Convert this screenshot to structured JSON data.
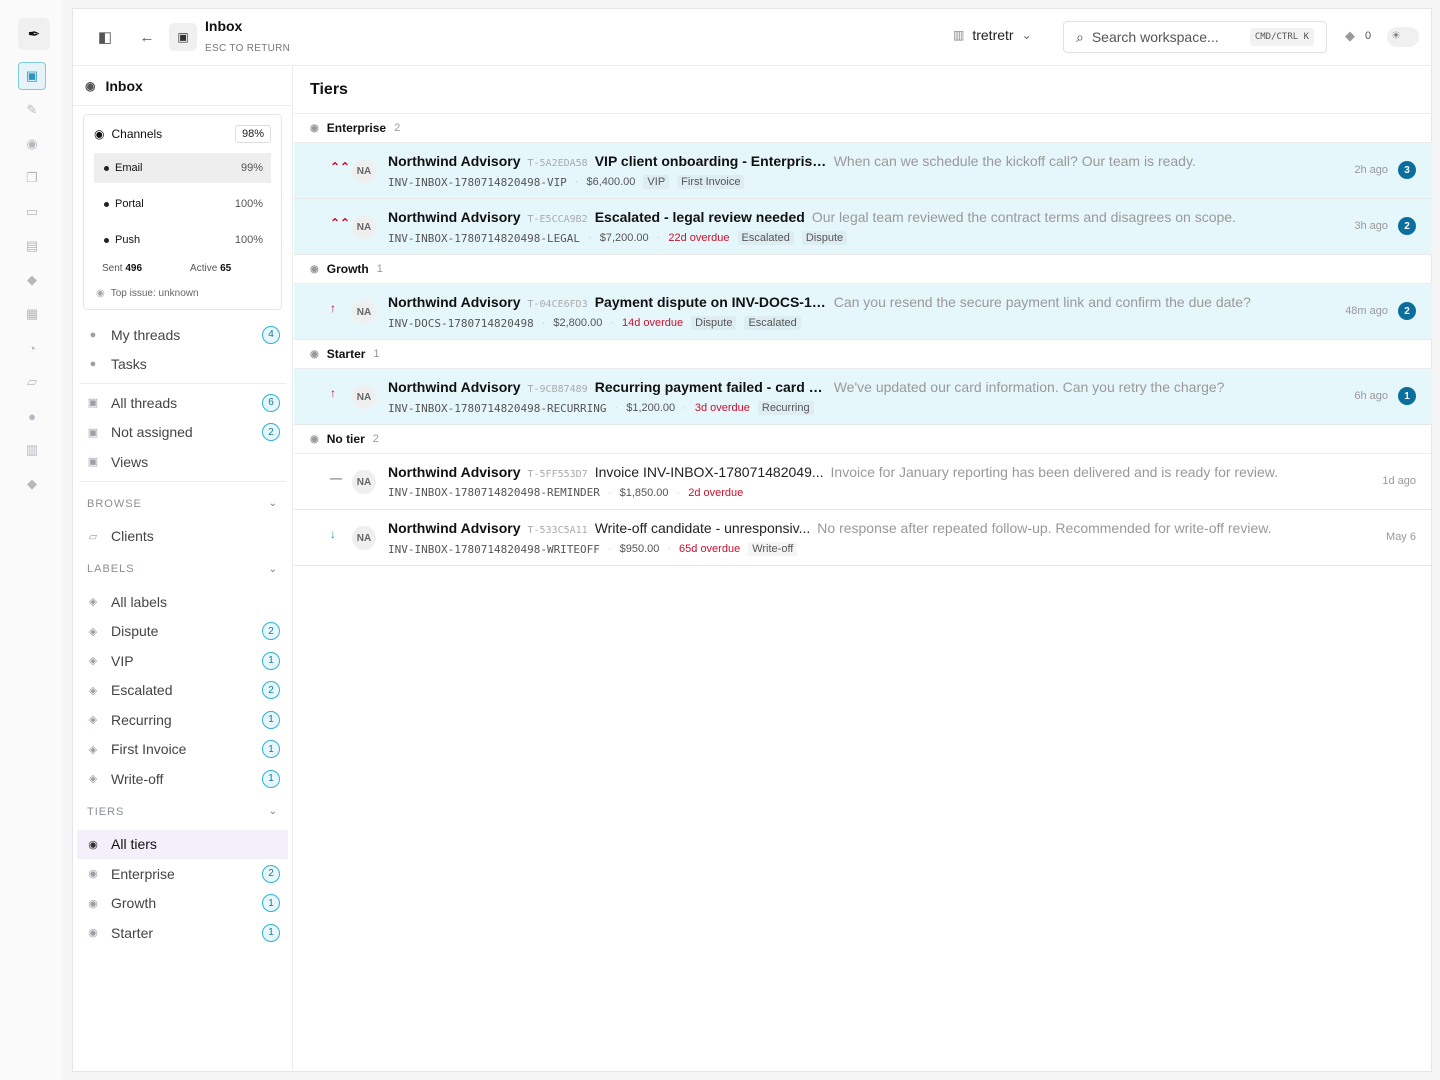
{
  "rail": {
    "logo_icon": "feather-icon",
    "items": [
      {
        "icon": "inbox-icon",
        "glyph": "▣",
        "active": true
      },
      {
        "icon": "wand-icon",
        "glyph": "✎"
      },
      {
        "icon": "globe-icon",
        "glyph": "◉"
      },
      {
        "icon": "copy-icon",
        "glyph": "❐"
      },
      {
        "icon": "card-icon",
        "glyph": "▭"
      },
      {
        "icon": "doc-edit-icon",
        "glyph": "▤"
      },
      {
        "icon": "bell-icon",
        "glyph": "◆"
      },
      {
        "icon": "doc-settings-icon",
        "glyph": "▦"
      },
      {
        "icon": "clock-icon",
        "glyph": "◔"
      },
      {
        "icon": "folder-icon",
        "glyph": "▱"
      },
      {
        "icon": "users-icon",
        "glyph": "●"
      },
      {
        "icon": "archive-icon",
        "glyph": "▥"
      },
      {
        "icon": "bell-alt-icon",
        "glyph": "◆"
      }
    ]
  },
  "topbar": {
    "title": "Inbox",
    "subtitle": "ESC TO RETURN",
    "workspace": "tretretr",
    "search_placeholder": "Search workspace...",
    "shortcut": "CMD/CTRL K",
    "notification_count": "0"
  },
  "sidebar": {
    "header": "Inbox",
    "channels": {
      "label": "Channels",
      "percent": "98%",
      "items": [
        {
          "name": "Email",
          "value": "99%",
          "selected": true
        },
        {
          "name": "Portal",
          "value": "100%"
        },
        {
          "name": "Push",
          "value": "100%"
        }
      ],
      "sent_label": "Sent",
      "sent_value": "496",
      "active_label": "Active",
      "active_value": "65",
      "top_issue": "Top issue: unknown"
    },
    "primary": [
      {
        "label": "My threads",
        "badge": "4",
        "icon": "user-icon"
      },
      {
        "label": "Tasks",
        "badge": "",
        "icon": "check-circle-icon"
      }
    ],
    "secondary": [
      {
        "label": "All threads",
        "badge": "6",
        "icon": "inbox-icon"
      },
      {
        "label": "Not assigned",
        "badge": "2",
        "icon": "user-x-icon"
      },
      {
        "label": "Views",
        "badge": "",
        "icon": "sliders-icon"
      }
    ],
    "browse": {
      "title": "BROWSE",
      "items": [
        {
          "label": "Clients",
          "icon": "folder-icon"
        }
      ]
    },
    "labels": {
      "title": "LABELS",
      "items": [
        {
          "label": "All labels",
          "badge": ""
        },
        {
          "label": "Dispute",
          "badge": "2"
        },
        {
          "label": "VIP",
          "badge": "1"
        },
        {
          "label": "Escalated",
          "badge": "2"
        },
        {
          "label": "Recurring",
          "badge": "1"
        },
        {
          "label": "First Invoice",
          "badge": "1"
        },
        {
          "label": "Write-off",
          "badge": "1"
        }
      ]
    },
    "tiers": {
      "title": "TIERS",
      "items": [
        {
          "label": "All tiers",
          "badge": "",
          "active": true
        },
        {
          "label": "Enterprise",
          "badge": "2"
        },
        {
          "label": "Growth",
          "badge": "1"
        },
        {
          "label": "Starter",
          "badge": "1"
        }
      ]
    }
  },
  "main": {
    "title": "Tiers",
    "groups": [
      {
        "name": "Enterprise",
        "count": "2",
        "rows": [
          {
            "prio": "⌃⌃",
            "prio_color": "#c8102e",
            "avatar": "NA",
            "client": "Northwind Advisory",
            "tid": "T-5A2EDA58",
            "subject": "VIP client onboarding - Enterprise...",
            "preview": "When can we schedule the kickoff call? Our team is ready.",
            "invoice": "INV-INBOX-1780714820498-VIP",
            "amount": "$6,400.00",
            "overdue": "",
            "tags": [
              "VIP",
              "First Invoice"
            ],
            "time": "2h ago",
            "count": "3",
            "highlight": true,
            "unread": true
          },
          {
            "prio": "⌃⌃",
            "prio_color": "#c8102e",
            "avatar": "NA",
            "client": "Northwind Advisory",
            "tid": "T-E5CCA9B2",
            "subject": "Escalated - legal review needed",
            "preview": "Our legal team reviewed the contract terms and disagrees on scope.",
            "invoice": "INV-INBOX-1780714820498-LEGAL",
            "amount": "$7,200.00",
            "overdue": "22d overdue",
            "tags": [
              "Escalated",
              "Dispute"
            ],
            "time": "3h ago",
            "count": "2",
            "highlight": true,
            "unread": true
          }
        ]
      },
      {
        "name": "Growth",
        "count": "1",
        "rows": [
          {
            "prio": "↑",
            "prio_color": "#c8102e",
            "avatar": "NA",
            "client": "Northwind Advisory",
            "tid": "T-04CE6FD3",
            "subject": "Payment dispute on INV-DOCS-17...",
            "preview": "Can you resend the secure payment link and confirm the due date?",
            "invoice": "INV-DOCS-1780714820498",
            "amount": "$2,800.00",
            "overdue": "14d overdue",
            "tags": [
              "Dispute",
              "Escalated"
            ],
            "time": "48m ago",
            "count": "2",
            "highlight": true,
            "unread": true
          }
        ]
      },
      {
        "name": "Starter",
        "count": "1",
        "rows": [
          {
            "prio": "↑",
            "prio_color": "#c8102e",
            "avatar": "NA",
            "client": "Northwind Advisory",
            "tid": "T-9CB87489",
            "subject": "Recurring payment failed - card e...",
            "preview": "We've updated our card information. Can you retry the charge?",
            "invoice": "INV-INBOX-1780714820498-RECURRING",
            "amount": "$1,200.00",
            "overdue": "3d overdue",
            "tags": [
              "Recurring"
            ],
            "time": "6h ago",
            "count": "1",
            "highlight": true,
            "unread": true
          }
        ]
      },
      {
        "name": "No tier",
        "count": "2",
        "rows": [
          {
            "prio": "—",
            "prio_color": "#888888",
            "avatar": "NA",
            "client": "Northwind Advisory",
            "tid": "T-5FF553D7",
            "subject": "Invoice INV-INBOX-178071482049...",
            "preview": "Invoice for January reporting has been delivered and is ready for review.",
            "invoice": "INV-INBOX-1780714820498-REMINDER",
            "amount": "$1,850.00",
            "overdue": "2d overdue",
            "tags": [],
            "time": "1d ago",
            "count": "",
            "highlight": false,
            "unread": false
          },
          {
            "prio": "↓",
            "prio_color": "#1b8fb3",
            "avatar": "NA",
            "client": "Northwind Advisory",
            "tid": "T-533C5A11",
            "subject": "Write-off candidate - unresponsiv...",
            "preview": "No response after repeated follow-up. Recommended for write-off review.",
            "invoice": "INV-INBOX-1780714820498-WRITEOFF",
            "amount": "$950.00",
            "overdue": "65d overdue",
            "tags": [
              "Write-off"
            ],
            "time": "May 6",
            "count": "",
            "highlight": false,
            "unread": false
          }
        ]
      }
    ]
  }
}
